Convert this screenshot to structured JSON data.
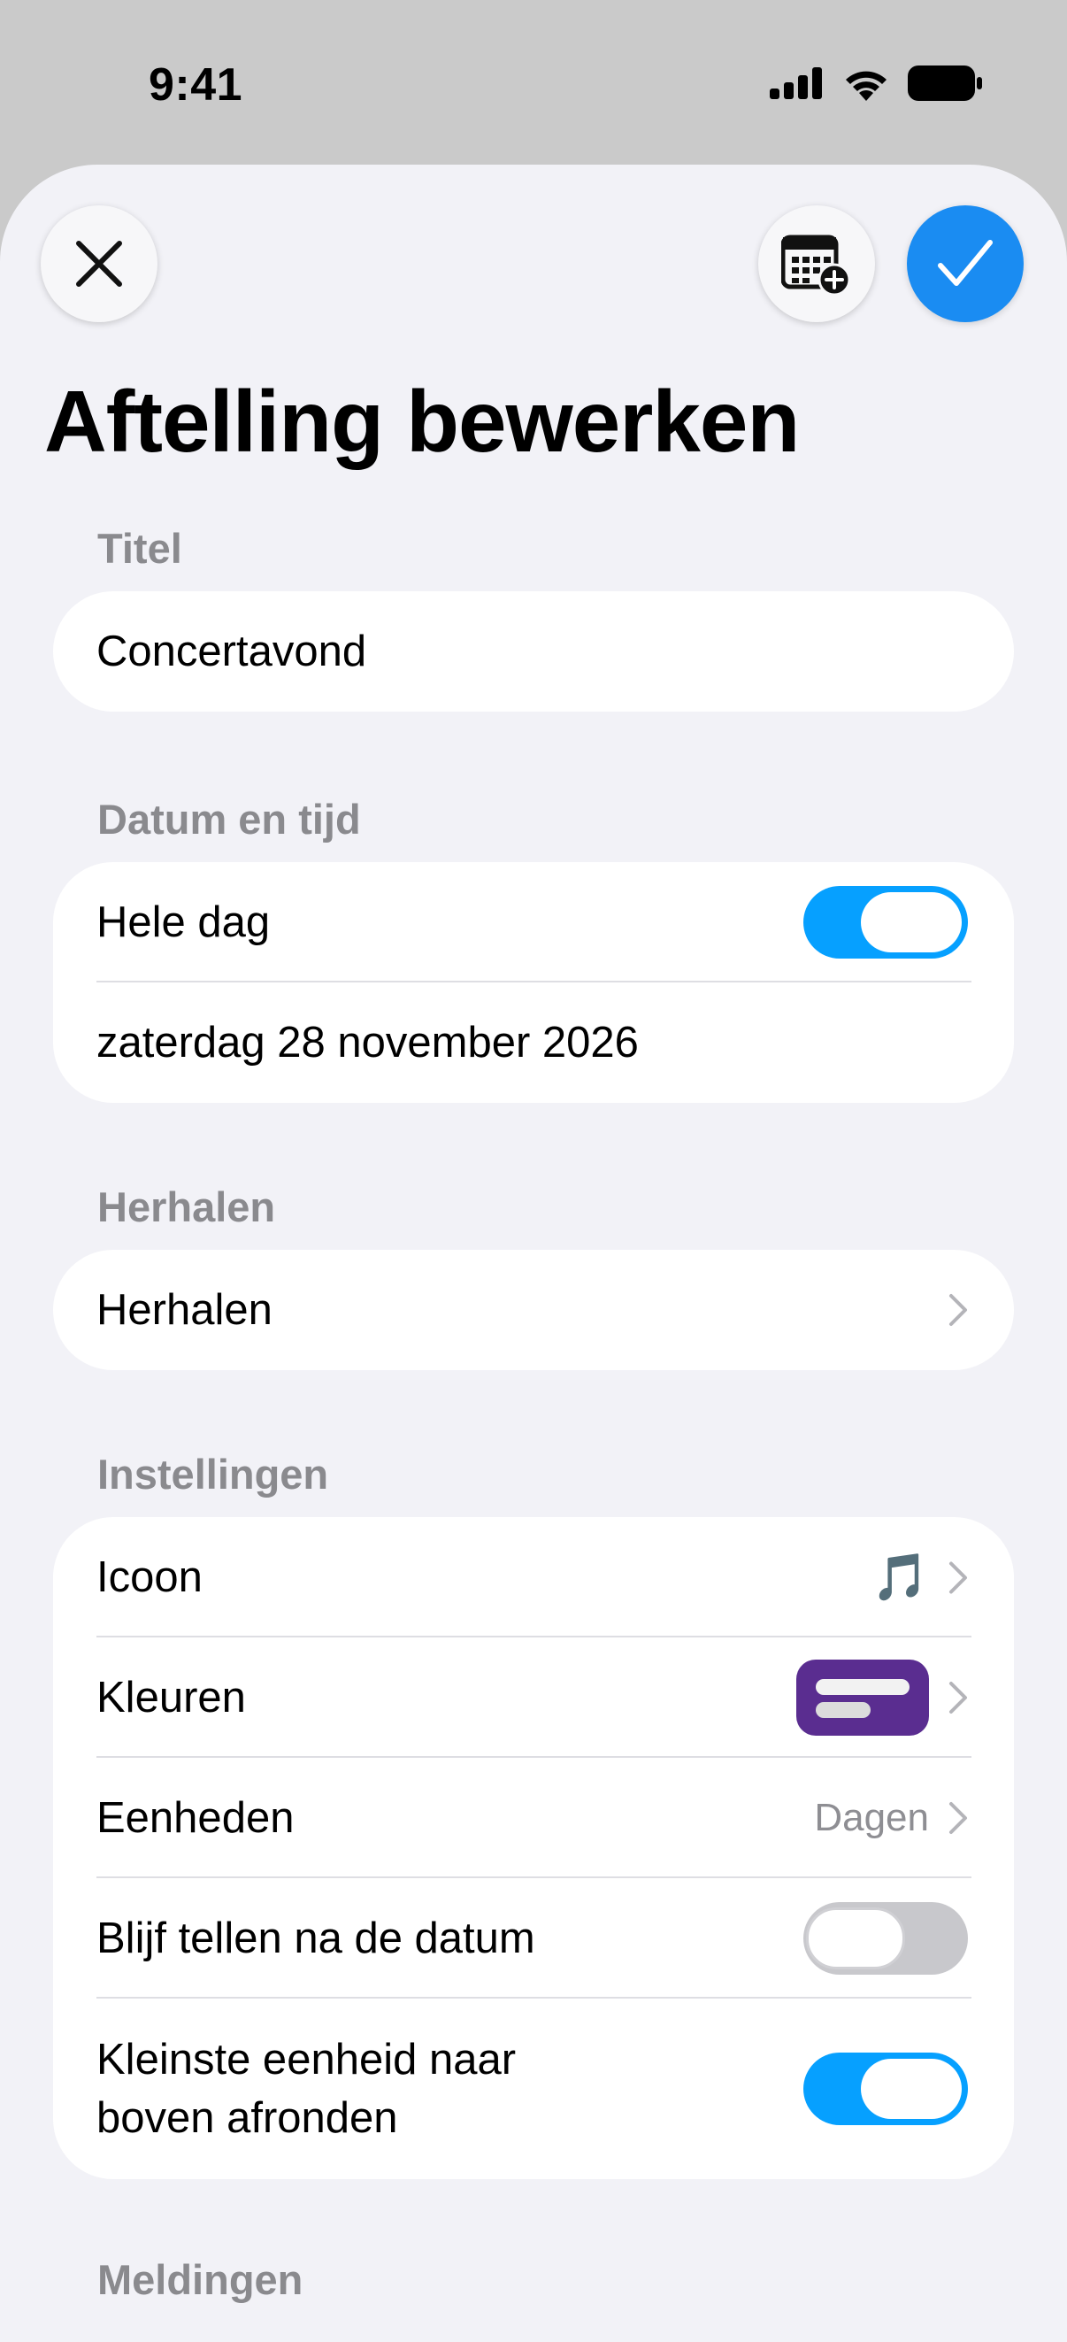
{
  "status_bar": {
    "time": "9:41"
  },
  "title": "Aftelling bewerken",
  "sections": {
    "title": {
      "label": "Titel",
      "value": "Concertavond"
    },
    "datetime": {
      "label": "Datum en tijd",
      "all_day_label": "Hele dag",
      "all_day_on": true,
      "date": "zaterdag 28 november 2026"
    },
    "repeat": {
      "label": "Herhalen",
      "row_label": "Herhalen"
    },
    "settings": {
      "label": "Instellingen",
      "icon_label": "Icoon",
      "icon_value": "🎵",
      "colors_label": "Kleuren",
      "swatch_color": "#5a2d90",
      "units_label": "Eenheden",
      "units_value": "Dagen",
      "keep_counting_label": "Blijf tellen na de datum",
      "keep_counting_on": false,
      "round_up_label_line1": "Kleinste eenheid naar",
      "round_up_label_line2": "boven afronden",
      "round_up_on": true
    },
    "notifications": {
      "label": "Meldingen"
    }
  },
  "colors": {
    "accent": "#06a0ff",
    "confirm": "#1a8cf2",
    "background": "#f2f2f7"
  }
}
